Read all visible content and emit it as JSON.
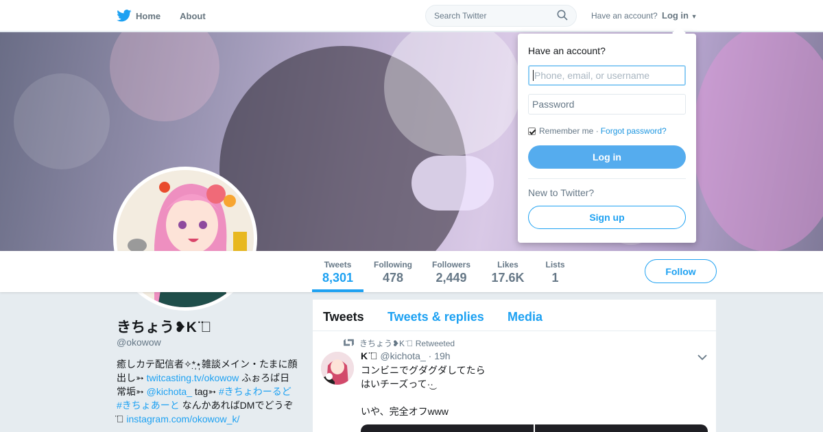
{
  "nav": {
    "home_label": "Home",
    "about_label": "About",
    "search_placeholder": "Search Twitter",
    "have_account": "Have an account?",
    "login_label": "Log in"
  },
  "profile": {
    "name": "きちょう❥K ̈⃝",
    "handle": "@okowow",
    "bio": {
      "t1": "癒しカテ配信者✧*̣̩⋆̩雑談メイン・たまに顔出し➳ ",
      "link1": "twitcasting.tv/okowow",
      "t2": " ふぉろば日常垢➳ ",
      "link2": "@kichota_",
      "t3": " tag➳ ",
      "link3": "#きちょわーるど",
      "t4": " ",
      "link4": "#きちょあーと",
      "t5": " なんかあればDMでどうぞ ̈⃝ ",
      "link5": "instagram.com/okowow_k/"
    }
  },
  "stats": [
    {
      "label": "Tweets",
      "value": "8,301"
    },
    {
      "label": "Following",
      "value": "478"
    },
    {
      "label": "Followers",
      "value": "2,449"
    },
    {
      "label": "Likes",
      "value": "17.6K"
    },
    {
      "label": "Lists",
      "value": "1"
    }
  ],
  "follow_label": "Follow",
  "timeline": {
    "tabs": [
      "Tweets",
      "Tweets & replies",
      "Media"
    ],
    "tweet": {
      "context": "きちょう❥K ̈⃝ Retweeted",
      "name": "K ̈⃝",
      "meta": " @kichota_ · 19h",
      "text": "コンビニでグダグダしてたら\nはいチーズって·͜·\n\nいや、完全オフwww"
    }
  },
  "login_dropdown": {
    "title": "Have an account?",
    "username_placeholder": "Phone, email, or username",
    "password_placeholder": "Password",
    "remember_label": "Remember me ·",
    "forgot_label": "Forgot password?",
    "login_button": "Log in",
    "new_label": "New to Twitter?",
    "signup_button": "Sign up"
  },
  "colors": {
    "accent": "#1da1f2",
    "login_button": "#55acee"
  }
}
